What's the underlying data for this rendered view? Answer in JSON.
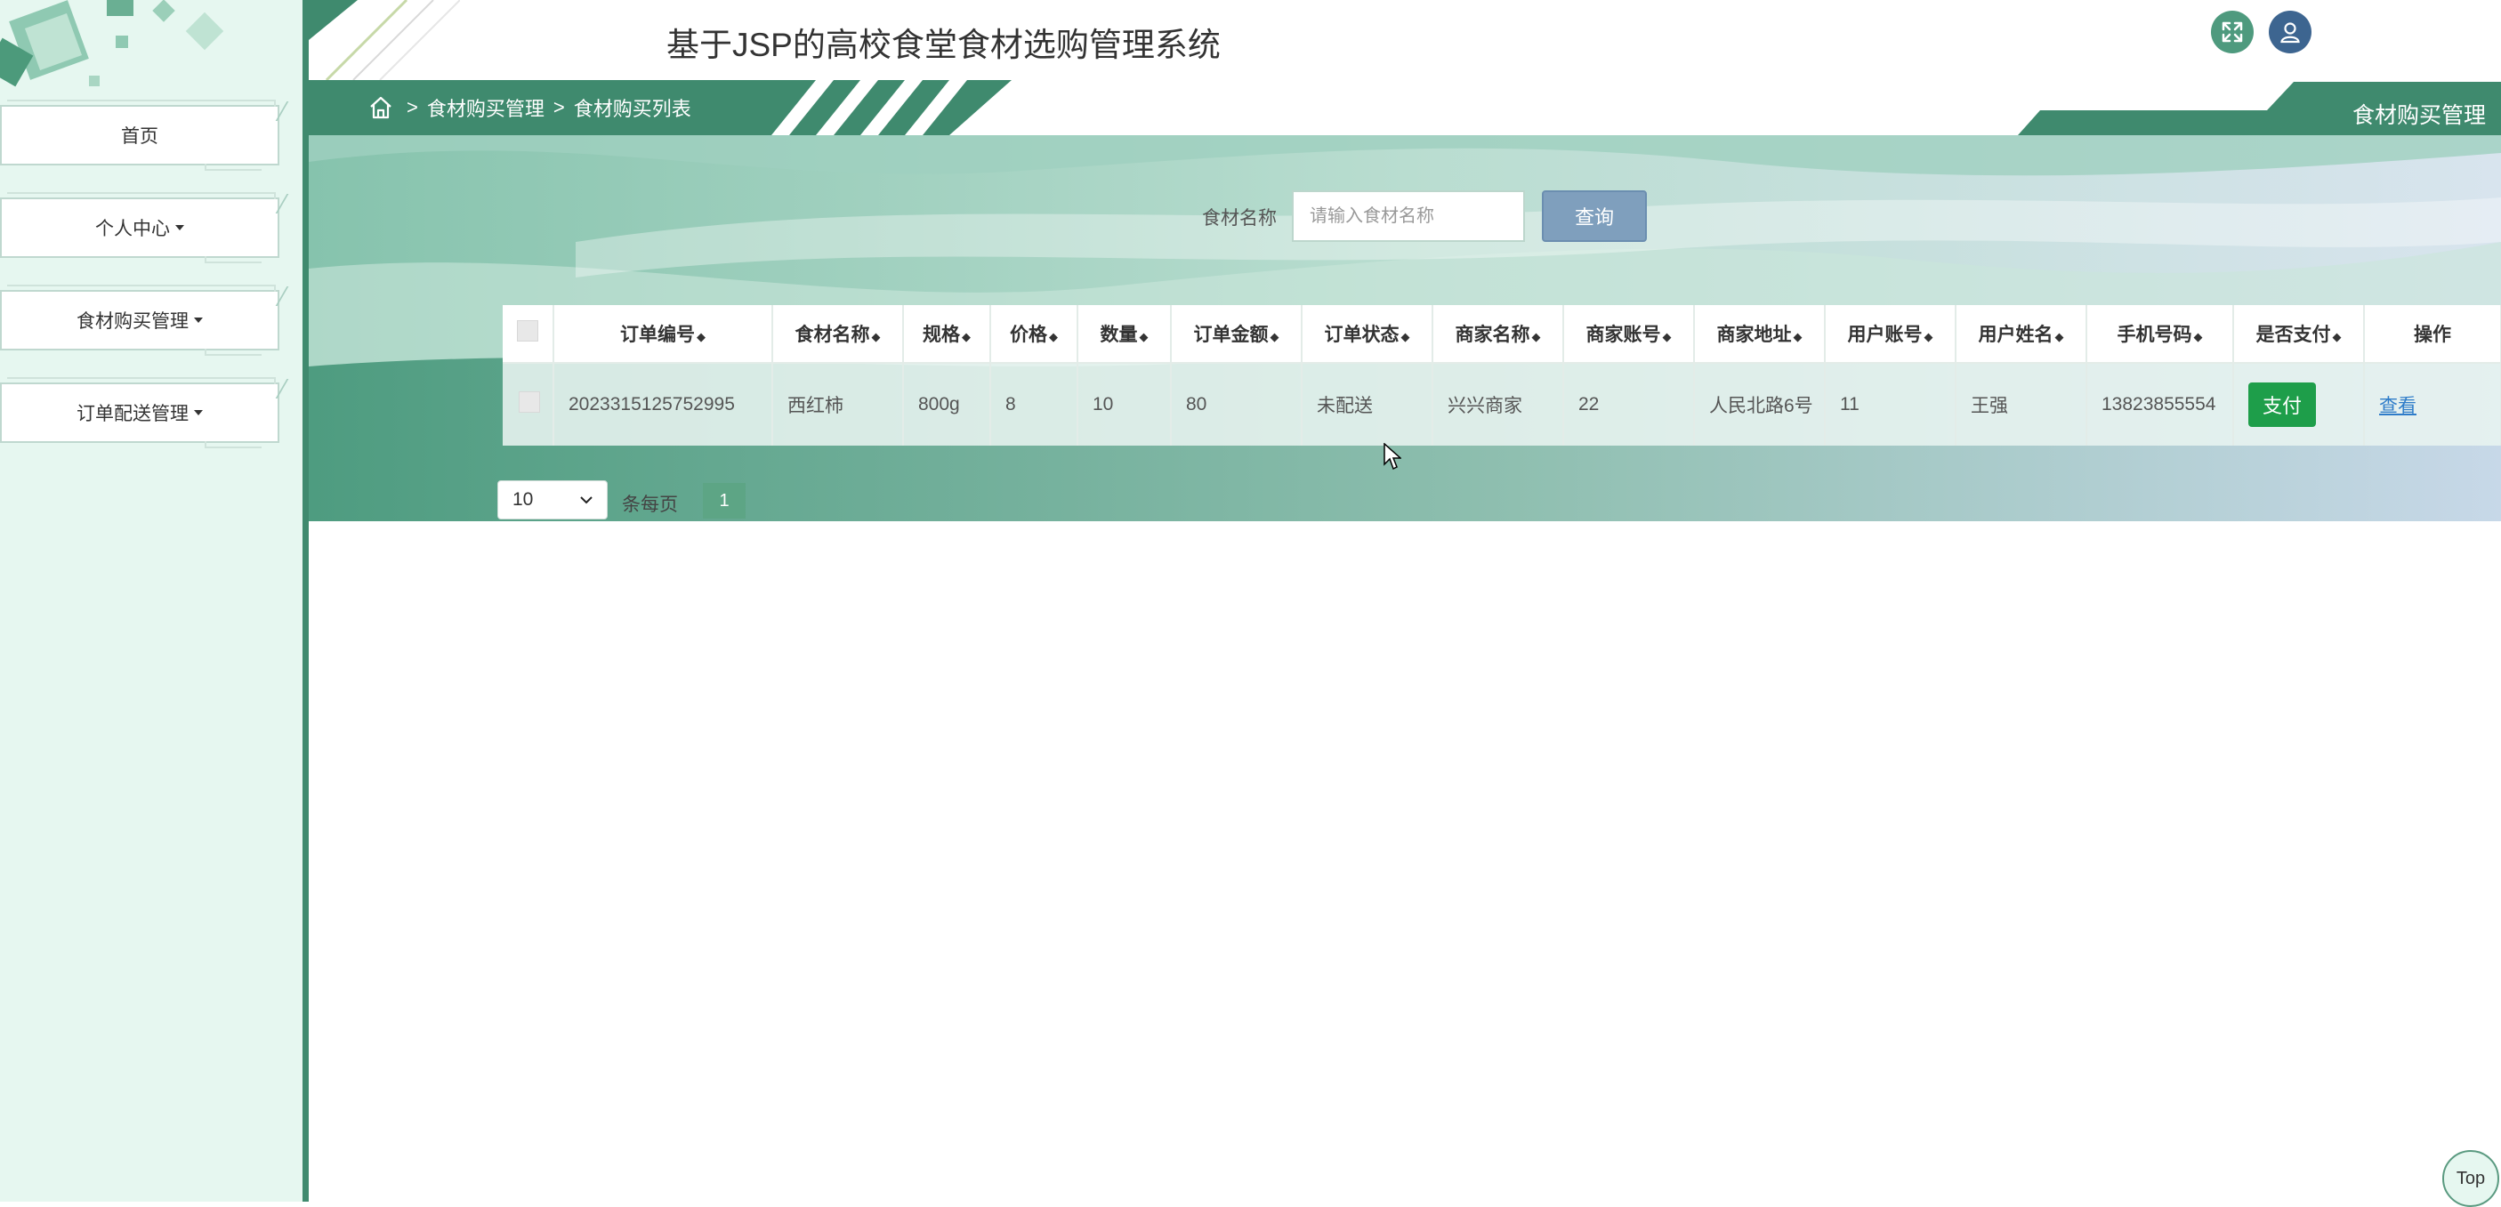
{
  "app": {
    "title": "基于JSP的高校食堂食材选购管理系统"
  },
  "sidebar": {
    "items": [
      {
        "label": "首页",
        "has_caret": false
      },
      {
        "label": "个人中心",
        "has_caret": true
      },
      {
        "label": "食材购买管理",
        "has_caret": true
      },
      {
        "label": "订单配送管理",
        "has_caret": true
      }
    ]
  },
  "header": {
    "fullscreen_icon": "fullscreen-icon",
    "user_icon": "user-icon",
    "accent": "#3f8a6e",
    "user_btn_color": "#3d6590"
  },
  "breadcrumb": {
    "sep": ">",
    "items": [
      "食材购买管理",
      "食材购买列表"
    ]
  },
  "page_tag": "食材购买管理",
  "search": {
    "label": "食材名称",
    "placeholder": "请输入食材名称",
    "button": "查询"
  },
  "table": {
    "columns": [
      "订单编号",
      "食材名称",
      "规格",
      "价格",
      "数量",
      "订单金额",
      "订单状态",
      "商家名称",
      "商家账号",
      "商家地址",
      "用户账号",
      "用户姓名",
      "手机号码",
      "是否支付",
      "操作"
    ],
    "rows": [
      {
        "order_no": "2023315125752995",
        "food_name": "西红柿",
        "spec": "800g",
        "price": "8",
        "qty": "10",
        "amount": "80",
        "status": "未配送",
        "merchant_name": "兴兴商家",
        "merchant_account": "22",
        "merchant_address": "人民北路6号",
        "user_account": "11",
        "user_name": "王强",
        "phone": "13823855554",
        "pay_label": "支付",
        "action_label": "查看"
      }
    ]
  },
  "pagination": {
    "page_size": "10",
    "per_page_label": "条每页",
    "current_page": "1"
  },
  "top_button": "Top"
}
